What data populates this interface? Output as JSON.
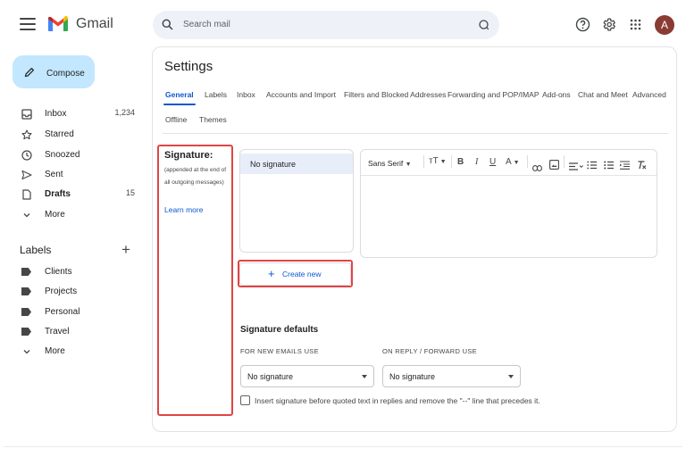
{
  "app": {
    "brand": "Gmail"
  },
  "search": {
    "placeholder": "Search mail"
  },
  "header": {
    "avatar_letter": "A"
  },
  "compose": {
    "label": "Compose"
  },
  "nav": [
    {
      "label": "Inbox",
      "count": "1,234",
      "icon": "inbox-icon"
    },
    {
      "label": "Starred",
      "count": "",
      "icon": "star-icon"
    },
    {
      "label": "Snoozed",
      "count": "",
      "icon": "clock-icon"
    },
    {
      "label": "Sent",
      "count": "",
      "icon": "send-icon"
    },
    {
      "label": "Drafts",
      "count": "15",
      "icon": "draft-icon"
    },
    {
      "label": "More",
      "count": "",
      "icon": "chevron-down-icon"
    }
  ],
  "labels_section": {
    "title": "Labels",
    "items": [
      "Clients",
      "Projects",
      "Personal",
      "Travel"
    ],
    "more": "More"
  },
  "settings": {
    "title": "Settings",
    "tabs": [
      "General",
      "Labels",
      "Inbox",
      "Accounts and Import",
      "Filters and Blocked Addresses",
      "Forwarding and POP/IMAP",
      "Add-ons",
      "Chat and Meet",
      "Advanced",
      "Offline",
      "Themes"
    ],
    "active_tab": "General"
  },
  "signature": {
    "title": "Signature:",
    "note": "(appended at the end of all outgoing messages)",
    "learn_more": "Learn more",
    "list_items": [
      "No signature"
    ],
    "create_new": "Create new",
    "editor_font": "Sans Serif",
    "defaults_title": "Signature defaults",
    "new_emails_label": "FOR NEW EMAILS USE",
    "reply_label": "ON REPLY / FORWARD USE",
    "new_emails_value": "No signature",
    "reply_value": "No signature",
    "checkbox_label": "Insert signature before quoted text in replies and remove the \"--\" line that precedes it.",
    "checkbox_checked": false
  },
  "colors": {
    "accent": "#0b57d0",
    "compose_bg": "#c2e7ff",
    "highlight": "#e04545"
  }
}
